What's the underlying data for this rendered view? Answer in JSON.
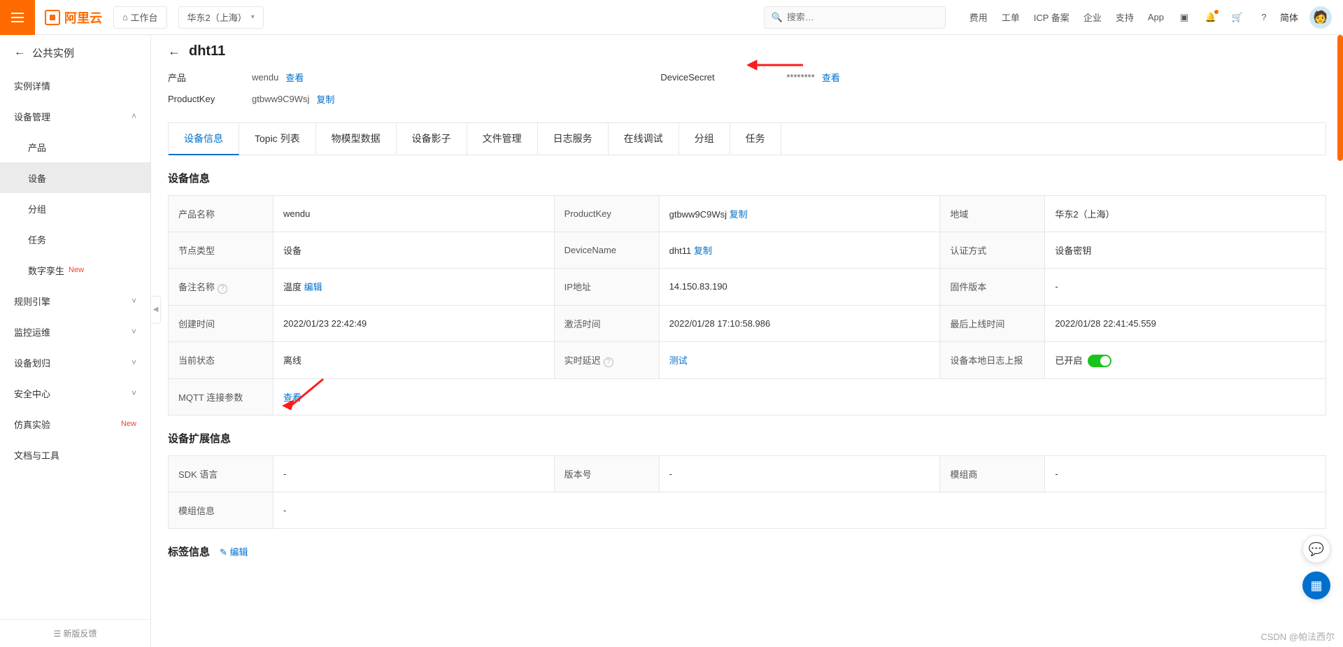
{
  "header": {
    "logo_text": "阿里云",
    "workspace": "工作台",
    "region": "华东2（上海）",
    "search_placeholder": "搜索…",
    "nav": [
      "费用",
      "工单",
      "ICP 备案",
      "企业",
      "支持",
      "App"
    ],
    "lang": "简体"
  },
  "sidebar": {
    "back": "公共实例",
    "detail": "实例详情",
    "device_mgmt": "设备管理",
    "children": [
      {
        "label": "产品",
        "active": false
      },
      {
        "label": "设备",
        "active": true
      },
      {
        "label": "分组",
        "active": false
      },
      {
        "label": "任务",
        "active": false
      },
      {
        "label": "数字孪生",
        "active": false,
        "new": true
      }
    ],
    "rule": "规则引擎",
    "ops": "监控运维",
    "alloc": "设备划归",
    "security": "安全中心",
    "sim": "仿真实验",
    "docs": "文档与工具",
    "feedback": "新版反馈",
    "new_label": "New"
  },
  "crumb": {
    "title": "dht11"
  },
  "overview": {
    "product_label": "产品",
    "product_value": "wendu",
    "view": "查看",
    "pk_label": "ProductKey",
    "pk_value": "gtbww9C9Wsj",
    "copy": "复制",
    "ds_label": "DeviceSecret",
    "ds_value": "********"
  },
  "tabs": [
    "设备信息",
    "Topic 列表",
    "物模型数据",
    "设备影子",
    "文件管理",
    "日志服务",
    "在线调试",
    "分组",
    "任务"
  ],
  "section1": "设备信息",
  "info": {
    "r1c1k": "产品名称",
    "r1c1v": "wendu",
    "r1c2k": "ProductKey",
    "r1c2v": "gtbww9C9Wsj",
    "r1c3k": "地域",
    "r1c3v": "华东2（上海）",
    "r2c1k": "节点类型",
    "r2c1v": "设备",
    "r2c2k": "DeviceName",
    "r2c2v": "dht11",
    "r2c3k": "认证方式",
    "r2c3v": "设备密钥",
    "r3c1k": "备注名称",
    "r3c1v": "温度",
    "r3c1edit": "编辑",
    "r3c2k": "IP地址",
    "r3c2v": "14.150.83.190",
    "r3c3k": "固件版本",
    "r3c3v": "-",
    "r4c1k": "创建时间",
    "r4c1v": "2022/01/23 22:42:49",
    "r4c2k": "激活时间",
    "r4c2v": "2022/01/28 17:10:58.986",
    "r4c3k": "最后上线时间",
    "r4c3v": "2022/01/28 22:41:45.559",
    "r5c1k": "当前状态",
    "r5c1v": "离线",
    "r5c2k": "实时延迟",
    "r5c2v": "测试",
    "r5c3k": "设备本地日志上报",
    "r5c3v": "已开启",
    "r6c1k": "MQTT 连接参数",
    "r6c1v": "查看"
  },
  "section2": "设备扩展信息",
  "ext": {
    "r1c1k": "SDK 语言",
    "r1c1v": "-",
    "r1c2k": "版本号",
    "r1c2v": "-",
    "r1c3k": "模组商",
    "r1c3v": "-",
    "r2c1k": "模组信息",
    "r2c1v": "-"
  },
  "section3": "标签信息",
  "section3_edit": "编辑",
  "watermark": "CSDN @帕法西尔"
}
